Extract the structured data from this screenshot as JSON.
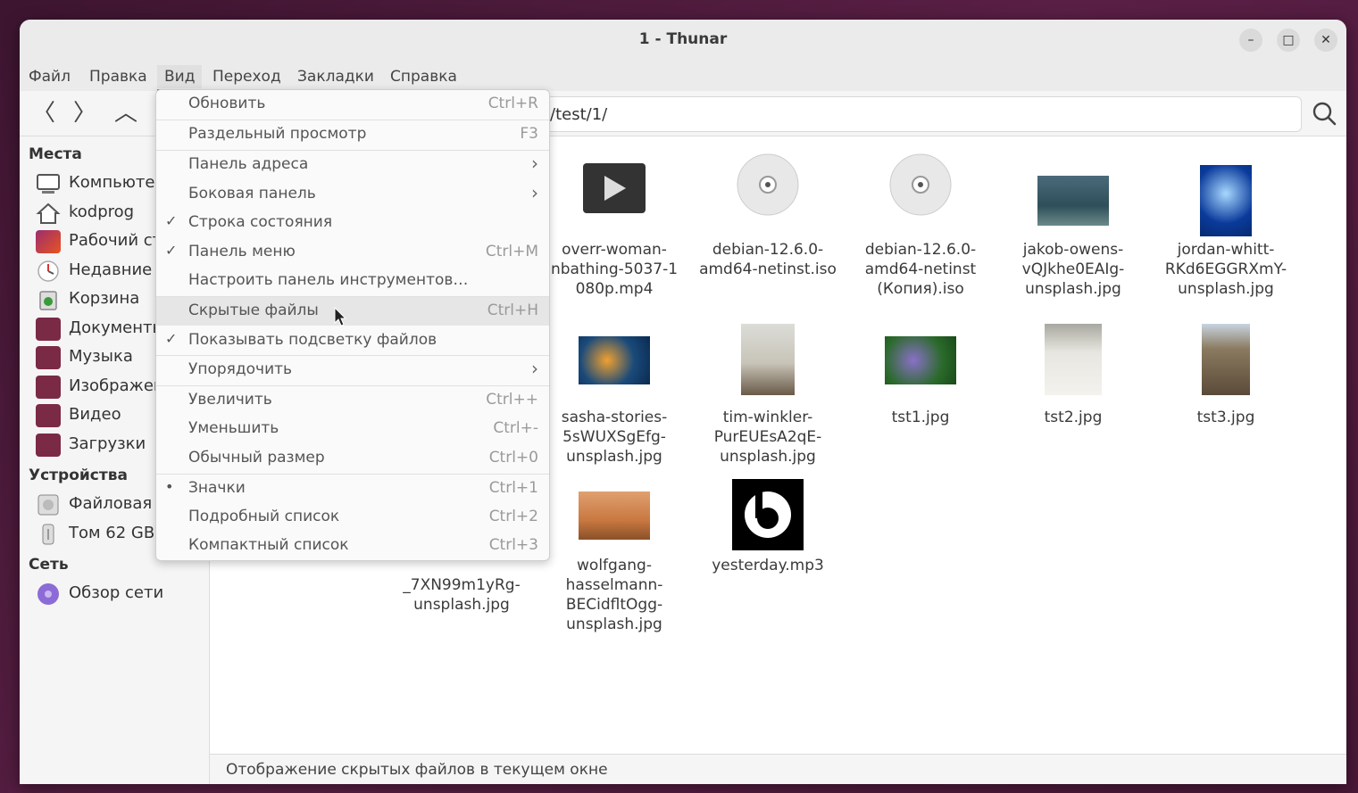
{
  "window": {
    "title": "1 - Thunar",
    "minimize_glyph": "–",
    "maximize_glyph": "□",
    "close_glyph": "✕"
  },
  "menubar": [
    "Файл",
    "Правка",
    "Вид",
    "Переход",
    "Закладки",
    "Справка"
  ],
  "toolbar": {
    "address": "/test/1/",
    "back_glyph": "〈",
    "forward_glyph": "〉",
    "up_glyph": "︿"
  },
  "sidebar": {
    "places_heading": "Места",
    "places": [
      {
        "label": "Компьютер",
        "icon": "computer-icon"
      },
      {
        "label": "kodprog",
        "icon": "home-icon"
      },
      {
        "label": "Рабочий ст",
        "icon": "desktop-folder-icon"
      },
      {
        "label": "Недавние",
        "icon": "recent-icon"
      },
      {
        "label": "Корзина",
        "icon": "trash-icon"
      },
      {
        "label": "Документы",
        "icon": "documents-folder-icon"
      },
      {
        "label": "Музыка",
        "icon": "music-folder-icon"
      },
      {
        "label": "Изображен",
        "icon": "pictures-folder-icon"
      },
      {
        "label": "Видео",
        "icon": "videos-folder-icon"
      },
      {
        "label": "Загрузки",
        "icon": "downloads-folder-icon"
      }
    ],
    "devices_heading": "Устройства",
    "devices": [
      {
        "label": "Файловая с",
        "icon": "drive-icon"
      },
      {
        "label": "Том 62 GB",
        "icon": "usb-drive-icon"
      }
    ],
    "network_heading": "Сеть",
    "network": [
      {
        "label": "Обзор сети",
        "icon": "network-icon"
      }
    ]
  },
  "view_menu": {
    "items": [
      {
        "label": "Обновить",
        "shortcut": "Ctrl+R"
      },
      {
        "label": "Раздельный просмотр",
        "shortcut": "F3"
      },
      {
        "label": "Панель адреса",
        "submenu": true,
        "arrow": "›"
      },
      {
        "label": "Боковая панель",
        "submenu": true,
        "arrow": "›"
      },
      {
        "label": "Строка состояния",
        "checked": true,
        "mark": "✓"
      },
      {
        "label": "Панель меню",
        "shortcut": "Ctrl+M",
        "checked": true,
        "mark": "✓"
      },
      {
        "label": "Настроить панель инструментов…"
      },
      {
        "label": "Скрытые файлы",
        "shortcut": "Ctrl+H",
        "highlighted": true
      },
      {
        "label": "Показывать подсветку файлов",
        "checked": true,
        "mark": "✓"
      },
      {
        "label": "Упорядочить",
        "submenu": true,
        "arrow": "›"
      },
      {
        "label": "Увеличить",
        "shortcut": "Ctrl++"
      },
      {
        "label": "Уменьшить",
        "shortcut": "Ctrl+-"
      },
      {
        "label": "Обычный размер",
        "shortcut": "Ctrl+0"
      },
      {
        "label": "Значки",
        "shortcut": "Ctrl+1",
        "radio": true,
        "mark": "•"
      },
      {
        "label": "Подробный список",
        "shortcut": "Ctrl+2"
      },
      {
        "label": "Компактный список",
        "shortcut": "Ctrl+3"
      }
    ]
  },
  "files": [
    {
      "name": "overr-woman-\nnbathing-5037-1\n080p.mp4",
      "kind": "video"
    },
    {
      "name": "debian-12.6.0-\namd64-netinst.iso",
      "kind": "disc"
    },
    {
      "name": "debian-12.6.0-\namd64-netinst\n(Копия).iso",
      "kind": "disc"
    },
    {
      "name": "jakob-owens-\nvQJkhe0EAIg-\nunsplash.jpg",
      "kind": "image"
    },
    {
      "name": "jordan-whitt-\nRKd6EGGRXmY-\nunsplash.jpg",
      "kind": "image"
    },
    {
      "name": "sasha-stories-\n5sWUXSgEfg-\nunsplash.jpg",
      "kind": "image"
    },
    {
      "name": "tim-winkler-\nPurEUEsA2qE-\nunsplash.jpg",
      "kind": "image"
    },
    {
      "name": "tst1.jpg",
      "kind": "image"
    },
    {
      "name": "tst2.jpg",
      "kind": "image"
    },
    {
      "name": "tst3.jpg",
      "kind": "image"
    },
    {
      "name": "_7XN99m1yRg-\nunsplash.jpg",
      "kind": "image"
    },
    {
      "name": "wolfgang-\nhasselmann-\nBECidfltOgg-\nunsplash.jpg",
      "kind": "image"
    },
    {
      "name": "yesterday.mp3",
      "kind": "audio"
    }
  ],
  "statusbar": {
    "text": "Отображение скрытых файлов в текущем окне"
  },
  "colors": {
    "accent": "#e95420",
    "menu_highlight": "#e6e6e6"
  }
}
